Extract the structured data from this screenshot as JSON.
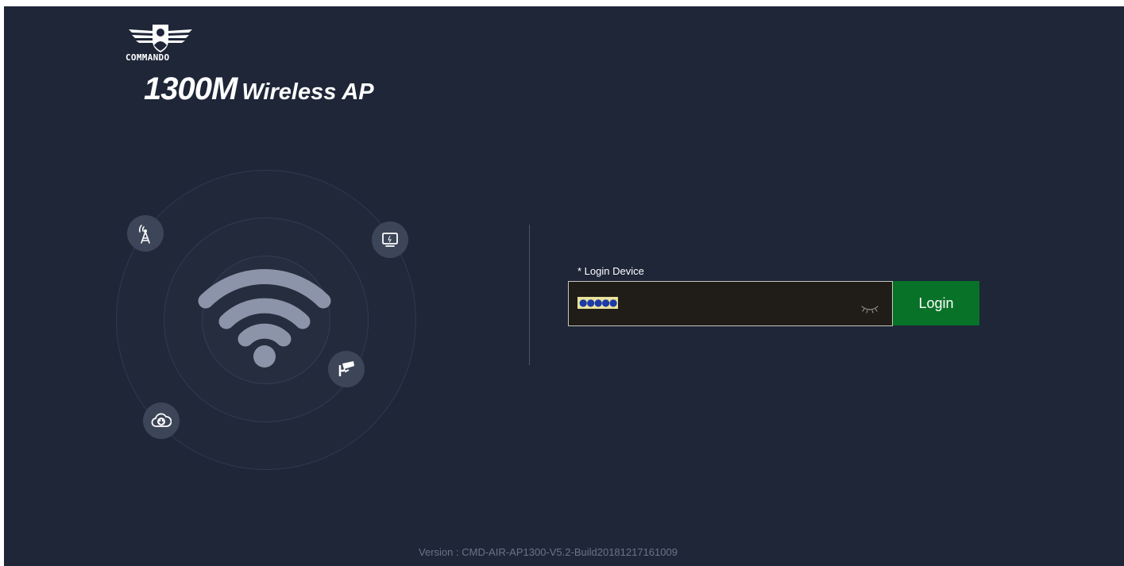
{
  "brand": {
    "logo_text": "COMMANDO",
    "product_model": "1300M",
    "product_name": "Wireless AP"
  },
  "illustration": {
    "icons": [
      "cell-tower-icon",
      "monitor-icon",
      "security-camera-icon",
      "cloud-download-icon",
      "wifi-icon"
    ]
  },
  "login": {
    "field_label": "* Login Device",
    "password_mask": "●●●●●",
    "button_label": "Login"
  },
  "footer": {
    "version": "Version : CMD-AIR-AP1300-V5.2-Build20181217161009"
  },
  "colors": {
    "background": "#1e2638",
    "accent_button": "#087228",
    "icon_circle": "#3d4658"
  }
}
